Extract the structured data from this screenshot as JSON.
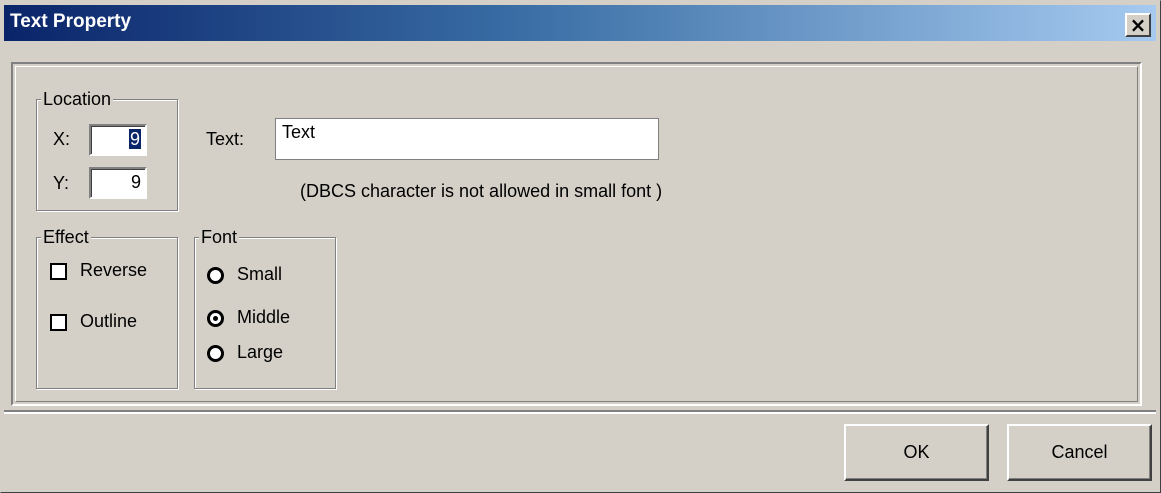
{
  "window": {
    "title": "Text Property",
    "close_label": "×"
  },
  "location": {
    "legend": "Location",
    "x_label": "X:",
    "x_value": "9",
    "y_label": "Y:",
    "y_value": "9"
  },
  "text": {
    "label": "Text:",
    "value": "Text",
    "note": "(DBCS character is not allowed in small font )"
  },
  "effect": {
    "legend": "Effect",
    "reverse_label": "Reverse",
    "reverse_checked": false,
    "outline_label": "Outline",
    "outline_checked": false
  },
  "font": {
    "legend": "Font",
    "small_label": "Small",
    "middle_label": "Middle",
    "large_label": "Large",
    "selected": "Middle"
  },
  "buttons": {
    "ok_label": "OK",
    "cancel_label": "Cancel"
  },
  "colors": {
    "title_start": "#0a246a",
    "title_end": "#a6caf0",
    "face": "#d4d0c8",
    "selection": "#0a246a"
  }
}
